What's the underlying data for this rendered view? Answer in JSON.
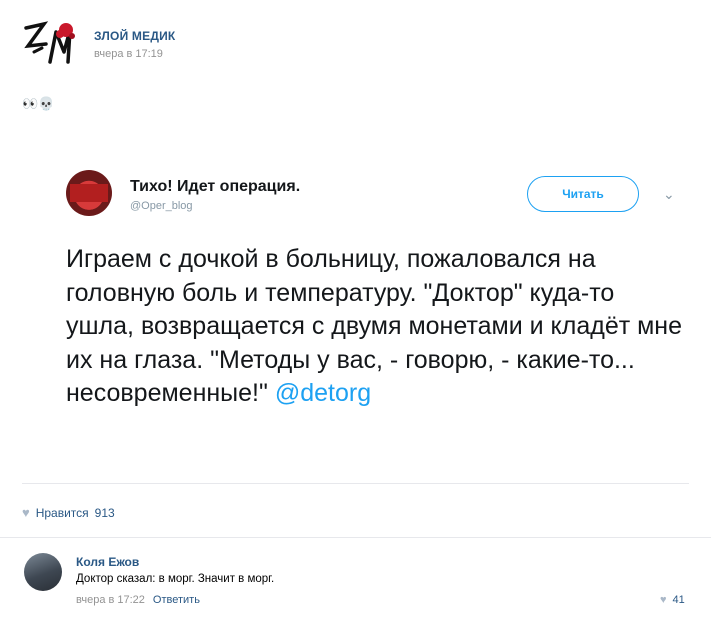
{
  "post": {
    "group_name": "ЗЛОЙ МЕДИК",
    "time": "вчера в 17:19",
    "emoji_text": "👀💀"
  },
  "tweet": {
    "name": "Тихо! Идет операция.",
    "handle": "@Oper_blog",
    "follow_label": "Читать",
    "text": "Играем с дочкой в больницу, пожаловался на головную боль и температуру. \"Доктор\" куда-то ушла, возвращается с двумя монетами и кладёт мне их на глаза. \"Методы у вас, - говорю, - какие-то... несовременные!\"",
    "mention": "@detorg"
  },
  "likes": {
    "label": "Нравится",
    "count": "913"
  },
  "comment": {
    "author": "Коля Ежов",
    "text": "Доктор сказал: в морг. Значит в морг.",
    "time": "вчера в 17:22",
    "reply_label": "Ответить",
    "likes": "41"
  },
  "colors": {
    "link": "#2a5885",
    "twitter_blue": "#1da1f2",
    "muted": "#939393"
  }
}
